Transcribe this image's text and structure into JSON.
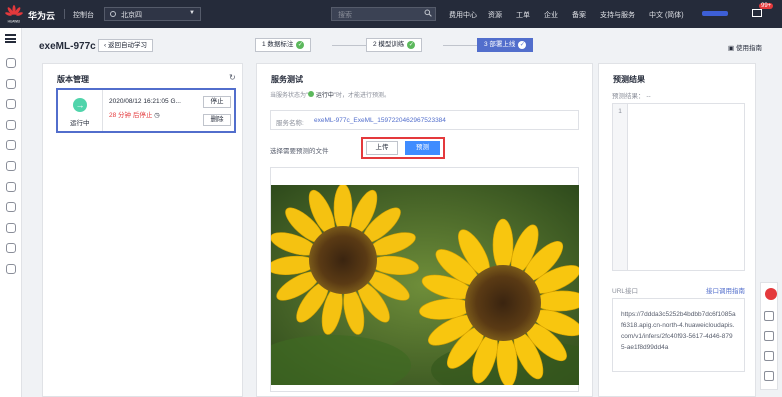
{
  "topbar": {
    "logo_text": "HUAWEI",
    "brand": "华为云",
    "console": "控制台",
    "region": "北京四",
    "search_placeholder": "搜索",
    "nav": [
      "费用中心",
      "资源",
      "工单",
      "企业",
      "备案",
      "支持与服务",
      "中文 (简体)"
    ],
    "badge": "99+",
    "colors": {
      "bar": "#252b3a",
      "accent": "#526ecc",
      "badge": "#e4393c"
    }
  },
  "page": {
    "title": "exeML-977c",
    "back_label": "返回自动学习",
    "steps": [
      {
        "label": "1 数据标注",
        "done": true
      },
      {
        "label": "2 模型训练",
        "done": true
      },
      {
        "label": "3 部署上线",
        "done": true,
        "active": true
      }
    ],
    "guide_label": "使用指南"
  },
  "versions": {
    "title": "版本管理",
    "card": {
      "status": "运行中",
      "time": "2020/08/12 16:21:05 G...",
      "stop_countdown": "28 分钟 后停止",
      "stop_btn": "停止",
      "delete_btn": "删除"
    }
  },
  "service": {
    "title": "服务测试",
    "hint_prefix": "当服务状态为\"",
    "hint_status": "运行中",
    "hint_suffix": "\"时，才能进行预测。",
    "name_label": "服务名称:",
    "name_value": "exeML-977c_ExeML_1597220462967523384",
    "choose_label": "选择需要预测的文件",
    "upload_btn": "上传",
    "predict_btn": "预测"
  },
  "result": {
    "title": "预测结果",
    "label": "预测结果：",
    "value": "--",
    "line_no": "1",
    "url_label": "URL接口",
    "url_guide": "接口调用指南",
    "url": "https://7ddda3c5252b4bdbb7dc6f1085af6318.apig.cn-north-4.huaweicloudapis.com/v1/infers/2fc40f93-5617-4d46-8795-ae1f8d99dd4a"
  }
}
